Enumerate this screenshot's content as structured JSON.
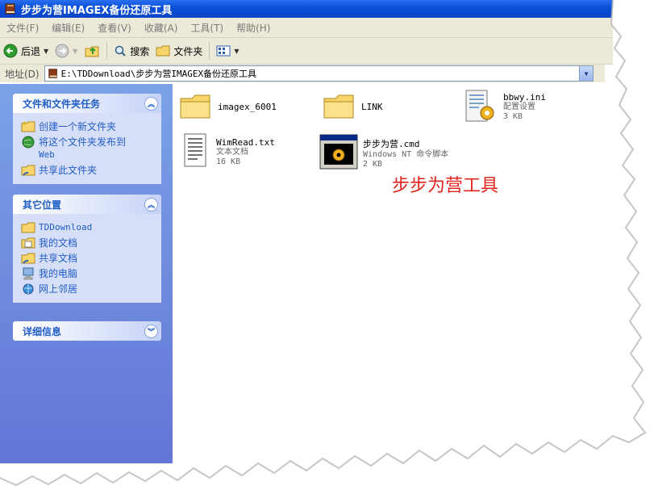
{
  "window": {
    "title": "步步为营IMAGEX备份还原工具"
  },
  "menu": [
    "文件(F)",
    "编辑(E)",
    "查看(V)",
    "收藏(A)",
    "工具(T)",
    "帮助(H)"
  ],
  "toolbar": {
    "back": "后退",
    "search": "搜索",
    "folders": "文件夹"
  },
  "address": {
    "label": "地址(D)",
    "path": "E:\\TDDownload\\步步为营IMAGEX备份还原工具"
  },
  "tasks": {
    "title": "文件和文件夹任务",
    "items": [
      {
        "label": "创建一个新文件夹",
        "icon": "new-folder-icon"
      },
      {
        "label": "将这个文件夹发布到",
        "sublabel": "Web",
        "icon": "publish-web-icon"
      },
      {
        "label": "共享此文件夹",
        "icon": "share-folder-icon"
      }
    ]
  },
  "other_places": {
    "title": "其它位置",
    "items": [
      {
        "label": "TDDownload",
        "icon": "folder-icon"
      },
      {
        "label": "我的文档",
        "icon": "my-documents-icon"
      },
      {
        "label": "共享文档",
        "icon": "shared-documents-icon"
      },
      {
        "label": "我的电脑",
        "icon": "my-computer-icon"
      },
      {
        "label": "网上邻居",
        "icon": "network-icon"
      }
    ]
  },
  "details": {
    "title": "详细信息"
  },
  "files": [
    {
      "name": "imagex_6001",
      "type": "folder"
    },
    {
      "name": "LINK",
      "type": "folder"
    },
    {
      "name": "bbwy.ini",
      "desc": "配置设置",
      "size": "3 KB",
      "type": "ini"
    },
    {
      "name": "WimRead.txt",
      "desc": "文本文档",
      "size": "16 KB",
      "type": "txt"
    },
    {
      "name": "步步为营.cmd",
      "desc": "Windows NT 命令脚本",
      "size": "2 KB",
      "type": "cmd"
    }
  ],
  "annotation": "步步为营工具"
}
